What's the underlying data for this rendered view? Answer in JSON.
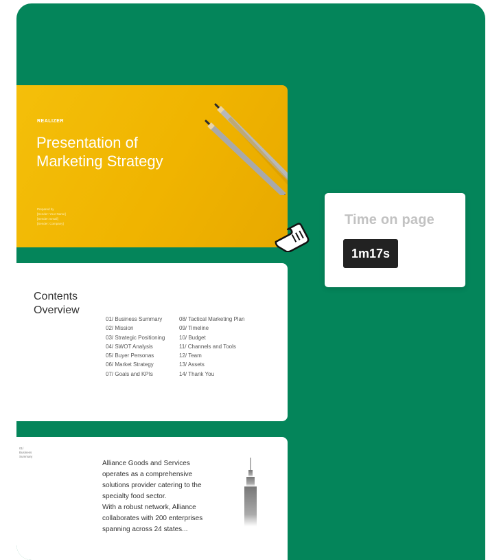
{
  "slides": {
    "cover": {
      "brand": "REALIZER",
      "title_line1": "Presentation of",
      "title_line2": "Marketing Strategy",
      "meta": [
        "Prepared by",
        "[Sender: Your Name]",
        "[Sender: Email]",
        "[Sender: Company]"
      ]
    },
    "contents": {
      "title_line1": "Contents",
      "title_line2": "Overview",
      "col1": [
        "01/ Business Summary",
        "02/ Mission",
        "03/ Strategic Positioning",
        "04/ SWOT Analysis",
        "05/ Buyer Personas",
        "06/ Market Strategy",
        "07/ Goals and KPIs"
      ],
      "col2": [
        "08/ Tactical Marketing Plan",
        "09/ Timeline",
        "10/ Budget",
        "11/ Channels and Tools",
        "12/ Team",
        "13/ Assets",
        "14/ Thank You"
      ]
    },
    "summary": {
      "label_num": "01/",
      "label_line1": "Business",
      "label_line2": "Summary",
      "body": [
        "Alliance Goods and Services",
        "operates as a comprehensive",
        "solutions provider catering to the",
        "specialty food sector.",
        "With a robust network, Alliance",
        "collaborates with 200 enterprises",
        "spanning across 24 states..."
      ]
    }
  },
  "tooltip": {
    "label": "Time on page",
    "value": "1m17s"
  },
  "colors": {
    "background": "#04855a",
    "cover_slide": "#f2b705",
    "tooltip_value_bg": "#222222"
  },
  "icons": {
    "cursor": "hand-pointer-icon"
  }
}
